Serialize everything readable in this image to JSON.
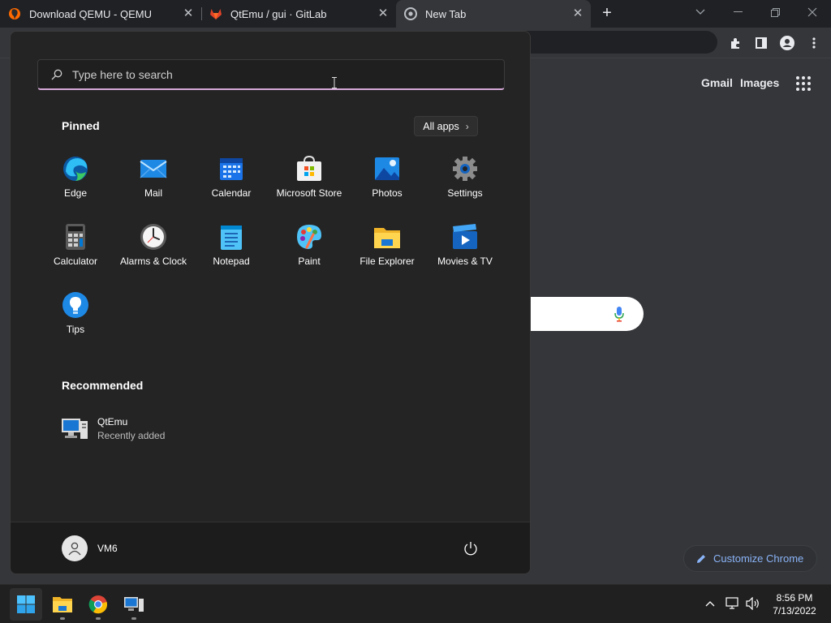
{
  "browser": {
    "tabs": [
      {
        "title": "Download QEMU - QEMU",
        "icon": "qemu-icon"
      },
      {
        "title": "QtEmu / gui · GitLab",
        "icon": "gitlab-icon"
      },
      {
        "title": "New Tab",
        "icon": "chrome-icon",
        "active": true
      }
    ],
    "new_tab_symbol": "+",
    "ntp": {
      "gmail": "Gmail",
      "images": "Images",
      "customize_label": "Customize Chrome"
    }
  },
  "start_menu": {
    "search_placeholder": "Type here to search",
    "pinned_title": "Pinned",
    "all_apps_label": "All apps",
    "pinned": [
      {
        "label": "Edge",
        "icon": "edge-icon"
      },
      {
        "label": "Mail",
        "icon": "mail-icon"
      },
      {
        "label": "Calendar",
        "icon": "calendar-icon"
      },
      {
        "label": "Microsoft Store",
        "icon": "store-icon"
      },
      {
        "label": "Photos",
        "icon": "photos-icon"
      },
      {
        "label": "Settings",
        "icon": "settings-icon"
      },
      {
        "label": "Calculator",
        "icon": "calculator-icon"
      },
      {
        "label": "Alarms & Clock",
        "icon": "clock-icon"
      },
      {
        "label": "Notepad",
        "icon": "notepad-icon"
      },
      {
        "label": "Paint",
        "icon": "paint-icon"
      },
      {
        "label": "File Explorer",
        "icon": "folder-icon"
      },
      {
        "label": "Movies & TV",
        "icon": "movies-icon"
      },
      {
        "label": "Tips",
        "icon": "tips-icon"
      }
    ],
    "recommended_title": "Recommended",
    "recommended": [
      {
        "title": "QtEmu",
        "subtitle": "Recently added",
        "icon": "qtemu-icon"
      }
    ],
    "user_name": "VM6"
  },
  "taskbar": {
    "apps": [
      "start-icon",
      "file-explorer-icon",
      "chrome-icon",
      "qtemu-icon"
    ],
    "time": "8:56 PM",
    "date": "7/13/2022"
  },
  "colors": {
    "accent": "#0078d4",
    "search_underline": "#d6a8d8",
    "chrome_link": "#8ab4f8"
  }
}
